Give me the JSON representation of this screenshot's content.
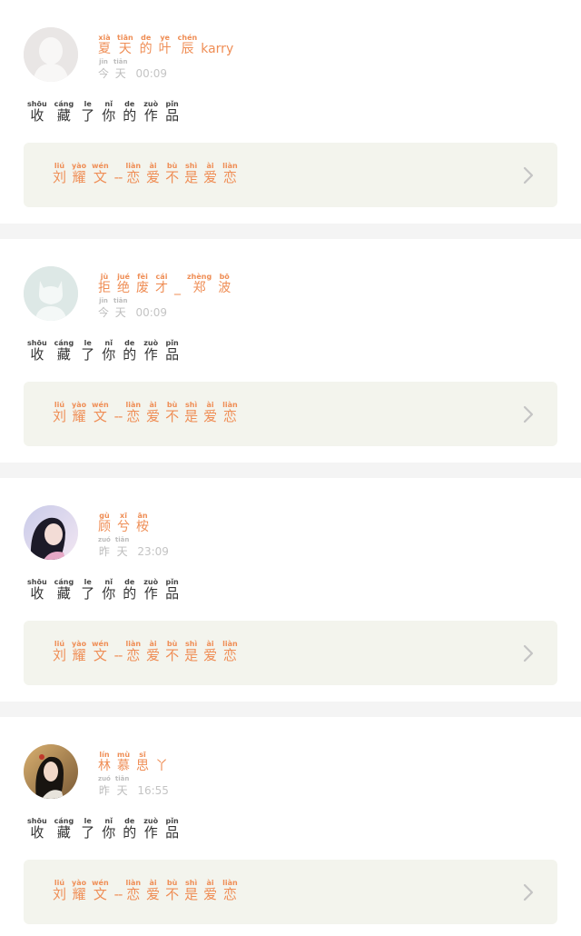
{
  "colors": {
    "accent": "#ef8e56",
    "card_bg": "#f3f4ed",
    "muted": "#bdbdbd",
    "text": "#333333",
    "separator": "#f4f4f4"
  },
  "notifications": [
    {
      "avatar": "avatar-silhouette-light",
      "nickname": {
        "chars": [
          {
            "py": "xià",
            "hz": "夏"
          },
          {
            "py": "tiān",
            "hz": "天"
          },
          {
            "py": "de",
            "hz": "的"
          },
          {
            "py": "ye",
            "hz": "叶"
          },
          {
            "py": "chén",
            "hz": "辰"
          }
        ],
        "suffix": "karry"
      },
      "time": {
        "chars": [
          {
            "py": "jīn",
            "hz": "今"
          },
          {
            "py": "tiān",
            "hz": "天"
          }
        ],
        "clock": "00:09"
      },
      "action": [
        {
          "py": "shōu",
          "hz": "收"
        },
        {
          "py": "cáng",
          "hz": "藏"
        },
        {
          "py": "le",
          "hz": "了"
        },
        {
          "py": "nǐ",
          "hz": "你"
        },
        {
          "py": "de",
          "hz": "的"
        },
        {
          "py": "zuò",
          "hz": "作"
        },
        {
          "py": "pǐn",
          "hz": "品"
        }
      ],
      "work": {
        "author": [
          {
            "py": "liú",
            "hz": "刘"
          },
          {
            "py": "yào",
            "hz": "耀"
          },
          {
            "py": "wén",
            "hz": "文"
          }
        ],
        "separator": "--",
        "title": [
          {
            "py": "liàn",
            "hz": "恋"
          },
          {
            "py": "ài",
            "hz": "爱"
          },
          {
            "py": "bù",
            "hz": "不"
          },
          {
            "py": "shì",
            "hz": "是"
          },
          {
            "py": "ài",
            "hz": "爱"
          },
          {
            "py": "liàn",
            "hz": "恋"
          }
        ]
      }
    },
    {
      "avatar": "avatar-cat-silhouette",
      "nickname": {
        "chars": [
          {
            "py": "jù",
            "hz": "拒"
          },
          {
            "py": "jué",
            "hz": "绝"
          },
          {
            "py": "fèi",
            "hz": "废"
          },
          {
            "py": "cái",
            "hz": "才"
          },
          {
            "py": "",
            "hz": "_"
          },
          {
            "py": "zhèng",
            "hz": "郑"
          },
          {
            "py": "bō",
            "hz": "波"
          }
        ],
        "suffix": ""
      },
      "time": {
        "chars": [
          {
            "py": "jīn",
            "hz": "今"
          },
          {
            "py": "tiān",
            "hz": "天"
          }
        ],
        "clock": "00:09"
      },
      "action": [
        {
          "py": "shōu",
          "hz": "收"
        },
        {
          "py": "cáng",
          "hz": "藏"
        },
        {
          "py": "le",
          "hz": "了"
        },
        {
          "py": "nǐ",
          "hz": "你"
        },
        {
          "py": "de",
          "hz": "的"
        },
        {
          "py": "zuò",
          "hz": "作"
        },
        {
          "py": "pǐn",
          "hz": "品"
        }
      ],
      "work": {
        "author": [
          {
            "py": "liú",
            "hz": "刘"
          },
          {
            "py": "yào",
            "hz": "耀"
          },
          {
            "py": "wén",
            "hz": "文"
          }
        ],
        "separator": "--",
        "title": [
          {
            "py": "liàn",
            "hz": "恋"
          },
          {
            "py": "ài",
            "hz": "爱"
          },
          {
            "py": "bù",
            "hz": "不"
          },
          {
            "py": "shì",
            "hz": "是"
          },
          {
            "py": "ài",
            "hz": "爱"
          },
          {
            "py": "liàn",
            "hz": "恋"
          }
        ]
      }
    },
    {
      "avatar": "avatar-girl-portrait",
      "nickname": {
        "chars": [
          {
            "py": "gù",
            "hz": "顾"
          },
          {
            "py": "xī",
            "hz": "兮"
          },
          {
            "py": "ān",
            "hz": "桉"
          }
        ],
        "suffix": ""
      },
      "time": {
        "chars": [
          {
            "py": "zuó",
            "hz": "昨"
          },
          {
            "py": "tiān",
            "hz": "天"
          }
        ],
        "clock": "23:09"
      },
      "action": [
        {
          "py": "shōu",
          "hz": "收"
        },
        {
          "py": "cáng",
          "hz": "藏"
        },
        {
          "py": "le",
          "hz": "了"
        },
        {
          "py": "nǐ",
          "hz": "你"
        },
        {
          "py": "de",
          "hz": "的"
        },
        {
          "py": "zuò",
          "hz": "作"
        },
        {
          "py": "pǐn",
          "hz": "品"
        }
      ],
      "work": {
        "author": [
          {
            "py": "liú",
            "hz": "刘"
          },
          {
            "py": "yào",
            "hz": "耀"
          },
          {
            "py": "wén",
            "hz": "文"
          }
        ],
        "separator": "--",
        "title": [
          {
            "py": "liàn",
            "hz": "恋"
          },
          {
            "py": "ài",
            "hz": "爱"
          },
          {
            "py": "bù",
            "hz": "不"
          },
          {
            "py": "shì",
            "hz": "是"
          },
          {
            "py": "ài",
            "hz": "爱"
          },
          {
            "py": "liàn",
            "hz": "恋"
          }
        ]
      }
    },
    {
      "avatar": "avatar-girl-photo",
      "nickname": {
        "chars": [
          {
            "py": "lín",
            "hz": "林"
          },
          {
            "py": "mù",
            "hz": "慕"
          },
          {
            "py": "sī",
            "hz": "思"
          },
          {
            "py": "",
            "hz": "丫"
          }
        ],
        "suffix": ""
      },
      "time": {
        "chars": [
          {
            "py": "zuó",
            "hz": "昨"
          },
          {
            "py": "tiān",
            "hz": "天"
          }
        ],
        "clock": "16:55"
      },
      "action": [
        {
          "py": "shōu",
          "hz": "收"
        },
        {
          "py": "cáng",
          "hz": "藏"
        },
        {
          "py": "le",
          "hz": "了"
        },
        {
          "py": "nǐ",
          "hz": "你"
        },
        {
          "py": "de",
          "hz": "的"
        },
        {
          "py": "zuò",
          "hz": "作"
        },
        {
          "py": "pǐn",
          "hz": "品"
        }
      ],
      "work": {
        "author": [
          {
            "py": "liú",
            "hz": "刘"
          },
          {
            "py": "yào",
            "hz": "耀"
          },
          {
            "py": "wén",
            "hz": "文"
          }
        ],
        "separator": "--",
        "title": [
          {
            "py": "liàn",
            "hz": "恋"
          },
          {
            "py": "ài",
            "hz": "爱"
          },
          {
            "py": "bù",
            "hz": "不"
          },
          {
            "py": "shì",
            "hz": "是"
          },
          {
            "py": "ài",
            "hz": "爱"
          },
          {
            "py": "liàn",
            "hz": "恋"
          }
        ]
      }
    }
  ]
}
